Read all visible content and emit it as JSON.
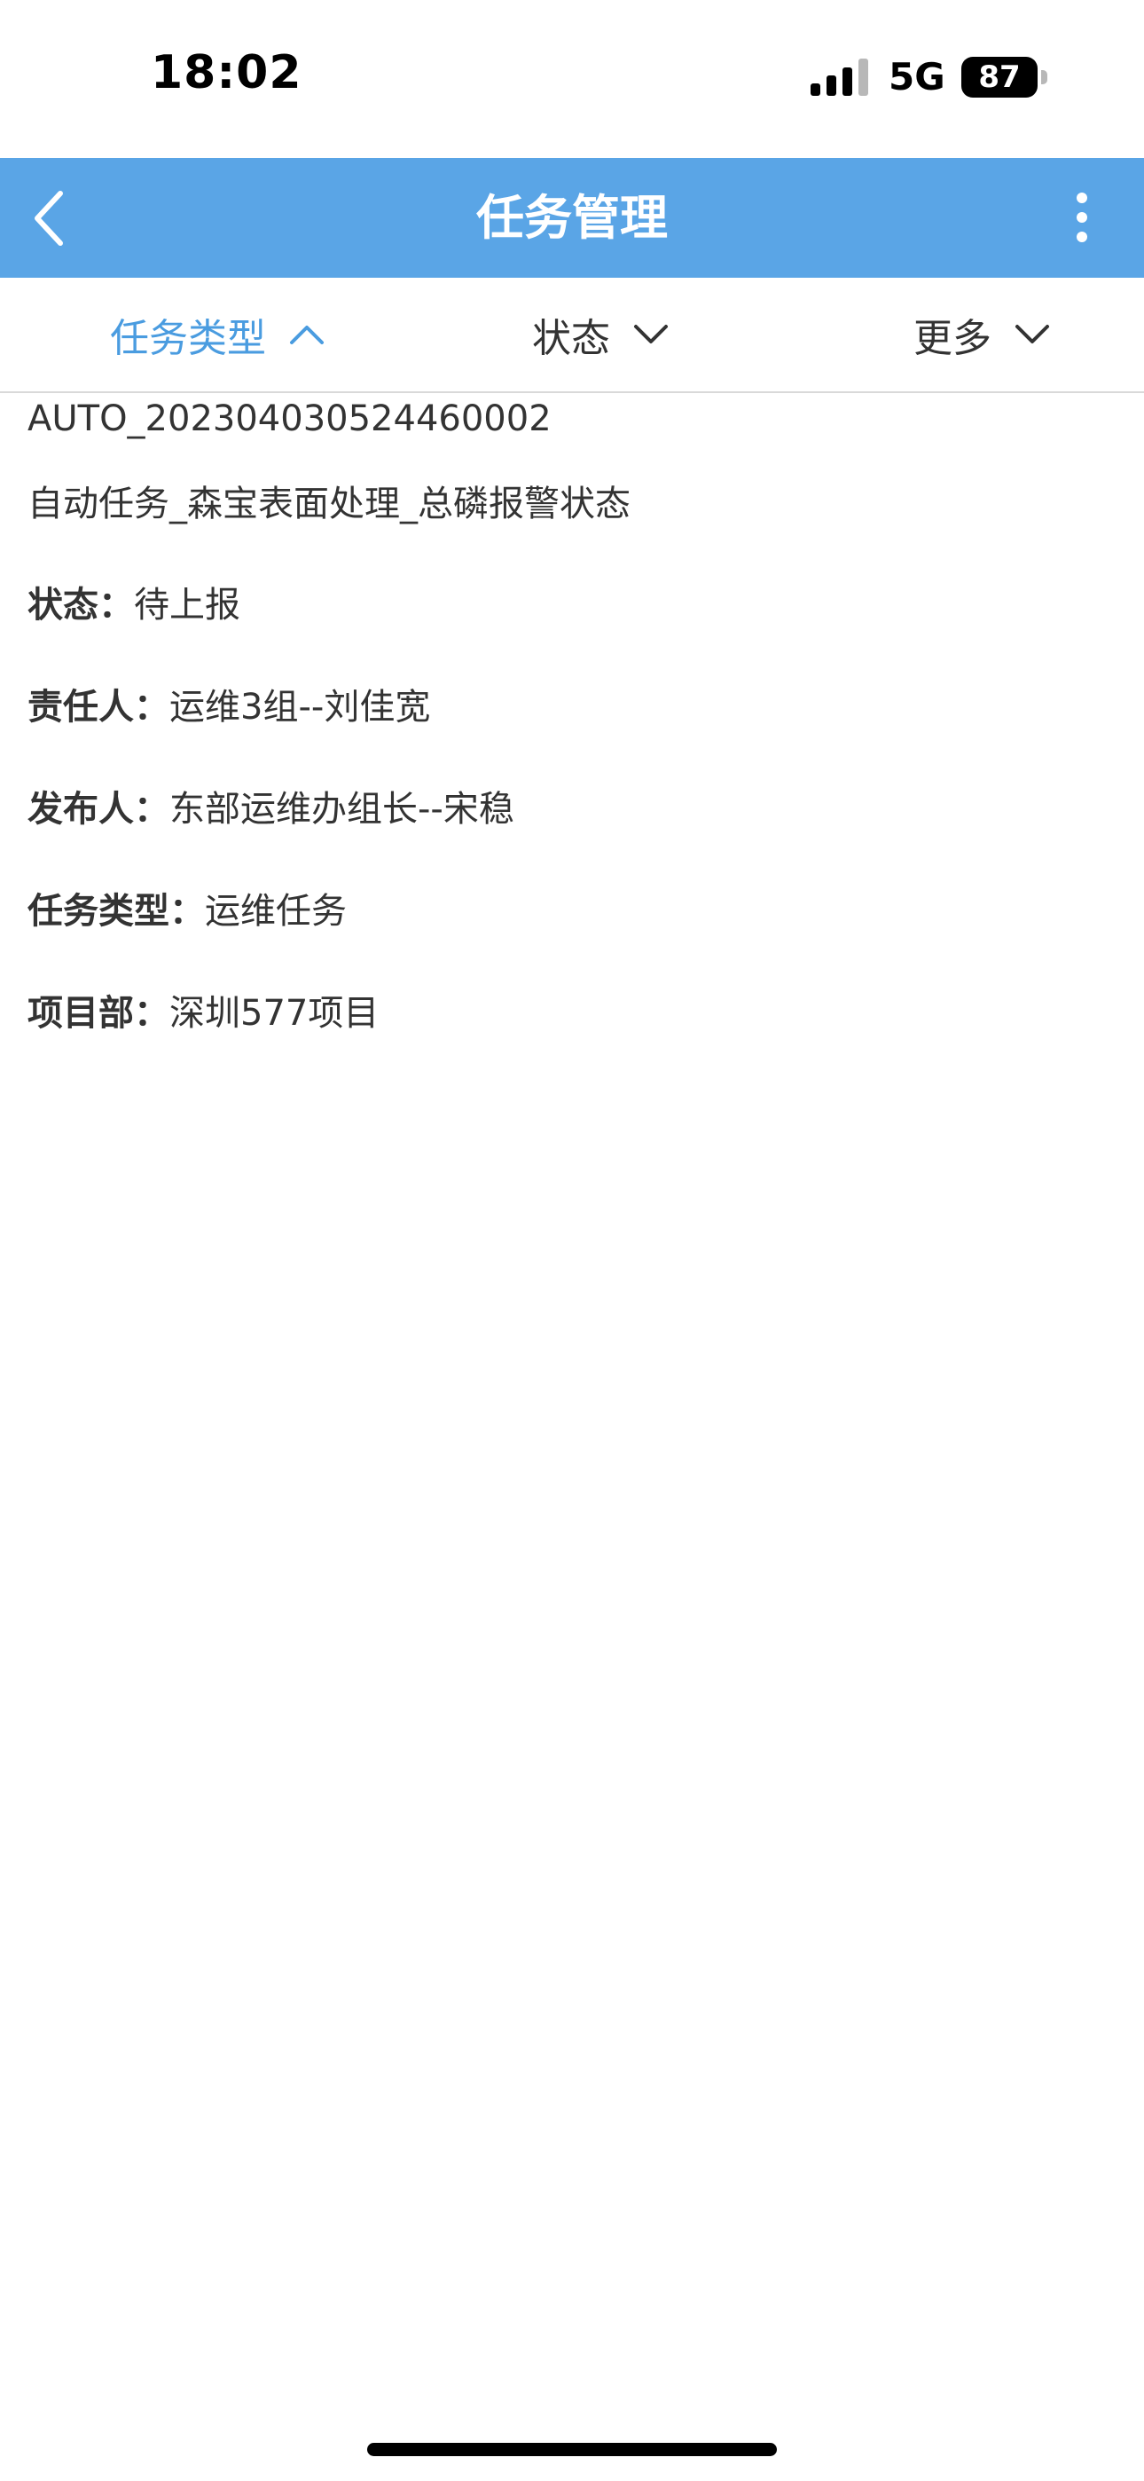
{
  "status_bar": {
    "time": "18:02",
    "network": "5G",
    "battery": "87",
    "icons": [
      "signal-icon",
      "battery-icon"
    ]
  },
  "nav": {
    "title": "任务管理",
    "back_icon": "chevron-left-icon",
    "more_icon": "more-vertical-icon",
    "color": "#5aa5e6"
  },
  "filters": {
    "task_type": {
      "label": "任务类型",
      "icon": "chevron-up-icon",
      "active": true,
      "color": "#4a9ce0"
    },
    "status": {
      "label": "状态",
      "icon": "chevron-down-icon"
    },
    "more": {
      "label": "更多",
      "icon": "chevron-down-icon"
    }
  },
  "task": {
    "code": "AUTO_202304030524460002",
    "name": "自动任务_森宝表面处理_总磷报警状态",
    "status": {
      "label": "状态：",
      "value": "待上报"
    },
    "owner": {
      "label": "责任人：",
      "value": "运维3组--刘佳宽"
    },
    "publisher": {
      "label": "发布人：",
      "value": "东部运维办组长--宋稳"
    },
    "task_type": {
      "label": "任务类型：",
      "value": "运维任务"
    },
    "project": {
      "label": "项目部：",
      "value": "深圳577项目"
    }
  }
}
